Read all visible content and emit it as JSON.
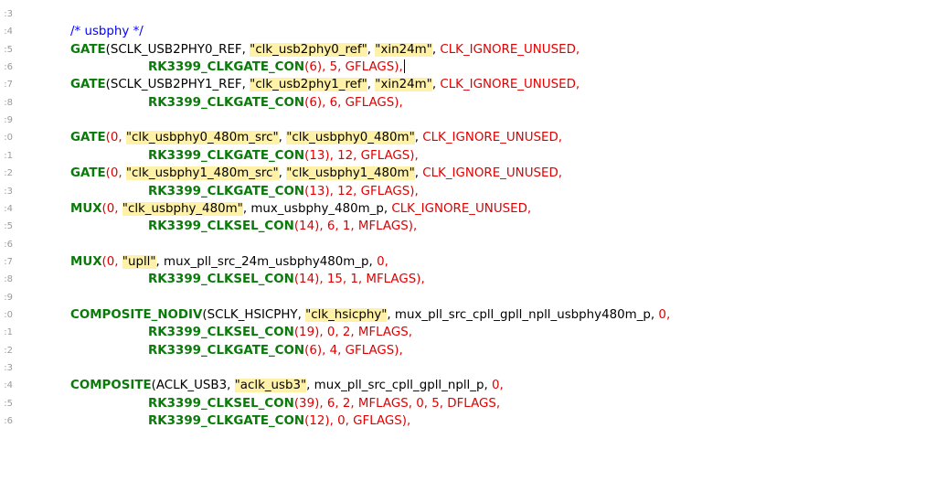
{
  "editor": {
    "lines": [
      {
        "num": "3:",
        "segs": []
      },
      {
        "num": "4:",
        "indent": false,
        "segs": [
          {
            "t": "/* usbphy */",
            "c": "cmt"
          }
        ]
      },
      {
        "num": "5:",
        "indent": false,
        "segs": [
          {
            "t": "GATE",
            "c": "kw"
          },
          {
            "t": "(SCLK_USB2PHY0_REF, "
          },
          {
            "t": "\"clk_usb2phy0_ref\"",
            "c": "str"
          },
          {
            "t": ", "
          },
          {
            "t": "\"xin24m\"",
            "c": "str"
          },
          {
            "t": ", "
          },
          {
            "t": "CLK_IGNORE_UNUSED,",
            "c": "red"
          }
        ]
      },
      {
        "num": "6:",
        "indent": true,
        "caret": true,
        "segs": [
          {
            "t": "RK3399_CLKGATE_CON",
            "c": "kw"
          },
          {
            "t": "(6), 5, GFLAGS),",
            "c": "red"
          }
        ]
      },
      {
        "num": "7:",
        "indent": false,
        "segs": [
          {
            "t": "GATE",
            "c": "kw"
          },
          {
            "t": "(SCLK_USB2PHY1_REF, "
          },
          {
            "t": "\"clk_usb2phy1_ref\"",
            "c": "str"
          },
          {
            "t": ", "
          },
          {
            "t": "\"xin24m\"",
            "c": "str"
          },
          {
            "t": ", "
          },
          {
            "t": "CLK_IGNORE_UNUSED,",
            "c": "red"
          }
        ]
      },
      {
        "num": "8:",
        "indent": true,
        "segs": [
          {
            "t": "RK3399_CLKGATE_CON",
            "c": "kw"
          },
          {
            "t": "(6), 6, GFLAGS),",
            "c": "red"
          }
        ]
      },
      {
        "num": "9:",
        "segs": []
      },
      {
        "num": "0:",
        "indent": false,
        "segs": [
          {
            "t": "GATE",
            "c": "kw"
          },
          {
            "t": "(0, ",
            "c": "red"
          },
          {
            "t": "\"clk_usbphy0_480m_src\"",
            "c": "str"
          },
          {
            "t": ", "
          },
          {
            "t": "\"clk_usbphy0_480m\"",
            "c": "str"
          },
          {
            "t": ", "
          },
          {
            "t": "CLK_IGNORE_UNUSED,",
            "c": "red"
          }
        ]
      },
      {
        "num": "1:",
        "indent": true,
        "segs": [
          {
            "t": "RK3399_CLKGATE_CON",
            "c": "kw"
          },
          {
            "t": "(13), 12, GFLAGS),",
            "c": "red"
          }
        ]
      },
      {
        "num": "2:",
        "indent": false,
        "segs": [
          {
            "t": "GATE",
            "c": "kw"
          },
          {
            "t": "(0, ",
            "c": "red"
          },
          {
            "t": "\"clk_usbphy1_480m_src\"",
            "c": "str"
          },
          {
            "t": ", "
          },
          {
            "t": "\"clk_usbphy1_480m\"",
            "c": "str"
          },
          {
            "t": ", "
          },
          {
            "t": "CLK_IGNORE_UNUSED,",
            "c": "red"
          }
        ]
      },
      {
        "num": "3:",
        "indent": true,
        "segs": [
          {
            "t": "RK3399_CLKGATE_CON",
            "c": "kw"
          },
          {
            "t": "(13), 12, GFLAGS),",
            "c": "red"
          }
        ]
      },
      {
        "num": "4:",
        "indent": false,
        "segs": [
          {
            "t": "MUX",
            "c": "kw"
          },
          {
            "t": "(0, ",
            "c": "red"
          },
          {
            "t": "\"clk_usbphy_480m\"",
            "c": "str"
          },
          {
            "t": ", mux_usbphy_480m_p, "
          },
          {
            "t": "CLK_IGNORE_UNUSED,",
            "c": "red"
          }
        ]
      },
      {
        "num": "5:",
        "indent": true,
        "segs": [
          {
            "t": "RK3399_CLKSEL_CON",
            "c": "kw"
          },
          {
            "t": "(14), 6, 1, MFLAGS),",
            "c": "red"
          }
        ]
      },
      {
        "num": "6:",
        "segs": []
      },
      {
        "num": "7:",
        "indent": false,
        "segs": [
          {
            "t": "MUX",
            "c": "kw"
          },
          {
            "t": "(0, ",
            "c": "red"
          },
          {
            "t": "\"upll\"",
            "c": "str"
          },
          {
            "t": ", mux_pll_src_24m_usbphy480m_p, "
          },
          {
            "t": "0,",
            "c": "red"
          }
        ]
      },
      {
        "num": "8:",
        "indent": true,
        "segs": [
          {
            "t": "RK3399_CLKSEL_CON",
            "c": "kw"
          },
          {
            "t": "(14), 15, 1, MFLAGS),",
            "c": "red"
          }
        ]
      },
      {
        "num": "9:",
        "segs": []
      },
      {
        "num": "0:",
        "indent": false,
        "segs": [
          {
            "t": "COMPOSITE_NODIV",
            "c": "kw"
          },
          {
            "t": "(SCLK_HSICPHY, "
          },
          {
            "t": "\"clk_hsicphy\"",
            "c": "str"
          },
          {
            "t": ", mux_pll_src_cpll_gpll_npll_usbphy480m_p, "
          },
          {
            "t": "0,",
            "c": "red"
          }
        ]
      },
      {
        "num": "1:",
        "indent": true,
        "segs": [
          {
            "t": "RK3399_CLKSEL_CON",
            "c": "kw"
          },
          {
            "t": "(19), 0, 2, MFLAGS,",
            "c": "red"
          }
        ]
      },
      {
        "num": "2:",
        "indent": true,
        "segs": [
          {
            "t": "RK3399_CLKGATE_CON",
            "c": "kw"
          },
          {
            "t": "(6), 4, GFLAGS),",
            "c": "red"
          }
        ]
      },
      {
        "num": "3:",
        "segs": []
      },
      {
        "num": "4:",
        "indent": false,
        "segs": [
          {
            "t": "COMPOSITE",
            "c": "kw"
          },
          {
            "t": "(ACLK_USB3, "
          },
          {
            "t": "\"aclk_usb3\"",
            "c": "str"
          },
          {
            "t": ", mux_pll_src_cpll_gpll_npll_p, "
          },
          {
            "t": "0,",
            "c": "red"
          }
        ]
      },
      {
        "num": "5:",
        "indent": true,
        "segs": [
          {
            "t": "RK3399_CLKSEL_CON",
            "c": "kw"
          },
          {
            "t": "(39), 6, 2, MFLAGS, 0, 5, DFLAGS,",
            "c": "red"
          }
        ]
      },
      {
        "num": "6:",
        "indent": true,
        "segs": [
          {
            "t": "RK3399_CLKGATE_CON",
            "c": "kw"
          },
          {
            "t": "(12), 0, GFLAGS),",
            "c": "red"
          }
        ]
      }
    ]
  }
}
